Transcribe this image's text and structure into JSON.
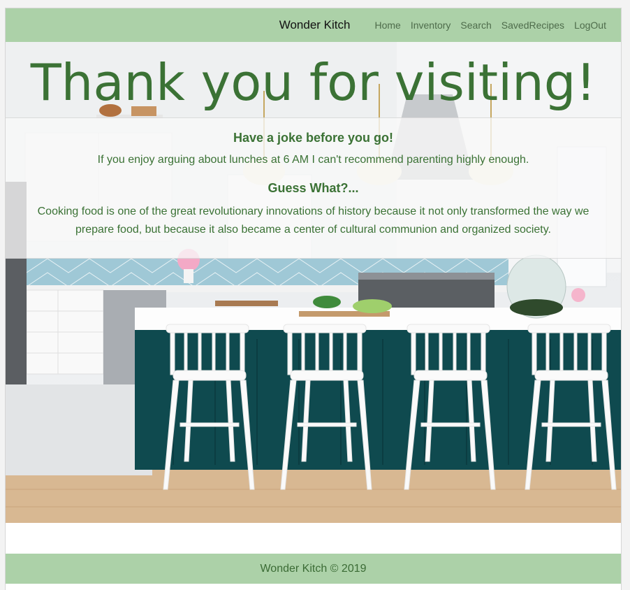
{
  "navbar": {
    "brand": "Wonder Kitch",
    "links": [
      "Home",
      "Inventory",
      "Search",
      "SavedRecipes",
      "LogOut"
    ]
  },
  "hero": {
    "title": "Thank you for visiting!",
    "background_icon": "kitchen-photo"
  },
  "joke": {
    "heading": "Have a joke before you go!",
    "text": "If you enjoy arguing about lunches at 6 AM I can't recommend parenting highly enough."
  },
  "fact": {
    "heading": "Guess What?...",
    "text": "Cooking food is one of the great revolutionary innovations of history because it not only transformed the way we prepare food, but because it also became a center of cultural communion and organized society."
  },
  "footer": {
    "text": "Wonder Kitch © 2019"
  },
  "colors": {
    "nav_bg": "#acd1a8",
    "text_green": "#3b7235",
    "island_teal": "#0f4a4f"
  }
}
